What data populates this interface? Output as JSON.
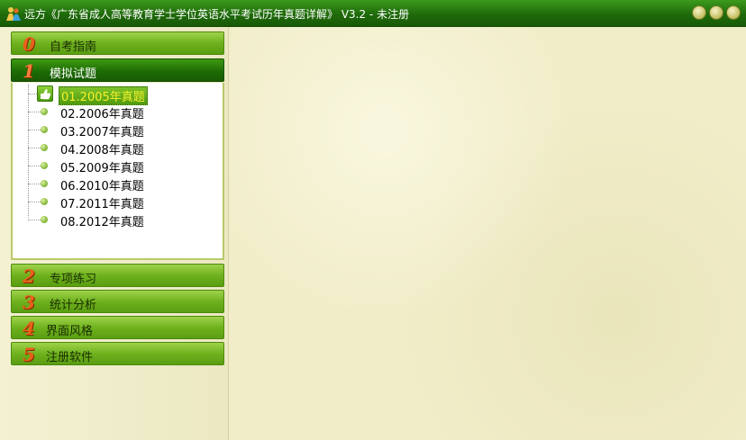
{
  "window": {
    "title": "远方《广东省成人高等教育学士学位英语水平考试历年真题详解》 V3.2 - 未注册",
    "icon": "people-app-icon",
    "buttons": [
      "minimize",
      "maximize",
      "close"
    ]
  },
  "sidebar": {
    "sections": [
      {
        "num": "0",
        "label": "自考指南",
        "active": false
      },
      {
        "num": "1",
        "label": "模拟试题",
        "active": true
      },
      {
        "num": "2",
        "label": "专项练习",
        "active": false
      },
      {
        "num": "3",
        "label": "统计分析",
        "active": false
      },
      {
        "num": "4",
        "label": "界面风格",
        "active": false
      },
      {
        "num": "5",
        "label": "注册软件",
        "active": false
      }
    ],
    "tree": [
      {
        "label": "01.2005年真题",
        "selected": true,
        "icon": "thumbs-up-icon"
      },
      {
        "label": "02.2006年真题",
        "selected": false
      },
      {
        "label": "03.2007年真题",
        "selected": false
      },
      {
        "label": "04.2008年真题",
        "selected": false
      },
      {
        "label": "05.2009年真题",
        "selected": false
      },
      {
        "label": "06.2010年真题",
        "selected": false
      },
      {
        "label": "07.2011年真题",
        "selected": false
      },
      {
        "label": "08.2012年真题",
        "selected": false
      }
    ]
  },
  "colors": {
    "titlebar": "#1f6a0b",
    "header_green": "#6fb21e",
    "header_active": "#1e6c05",
    "number_orange": "#e8611a",
    "background": "#efeccb"
  }
}
